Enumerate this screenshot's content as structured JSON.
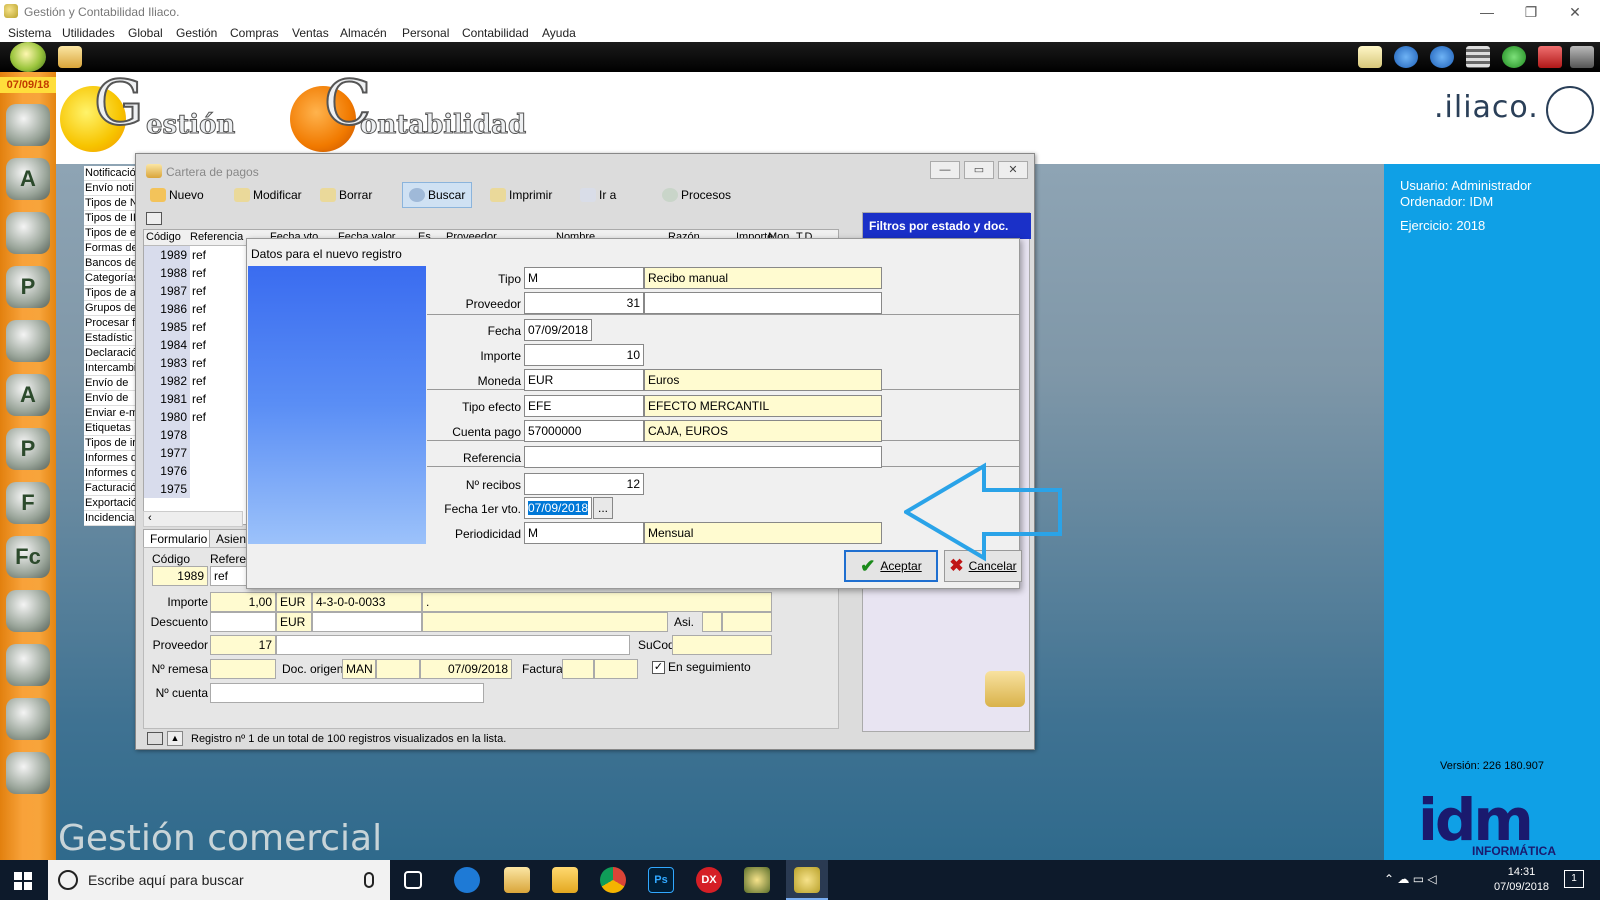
{
  "window": {
    "title": "Gestión y Contabilidad Iliaco.",
    "controls": [
      "—",
      "❐",
      "✕"
    ]
  },
  "menu": [
    "Sistema",
    "Utilidades",
    "Global",
    "Gestión",
    "Compras",
    "Ventas",
    "Almacén",
    "Personal",
    "Contabilidad",
    "Ayuda"
  ],
  "sidebar": {
    "date": "07/09/18"
  },
  "logos": {
    "gestion_letter": "G",
    "gestion_rest": "estión",
    "contab_letter": "C",
    "contab_rest": "ontabilidad",
    "brand": ".iliaco.",
    "footer": "Gestión comercial"
  },
  "user_panel": {
    "usuario": "Usuario: Administrador",
    "ordenador": "Ordenador: IDM",
    "ejercicio": "Ejercicio: 2018",
    "version": "Versión: 226 180.907",
    "idm": "idm",
    "idm_sub": "INFORMÁTICA"
  },
  "bg_list": [
    "Notificació",
    "Envío noti",
    "Tipos de N",
    "Tipos de II",
    "Tipos de e",
    "Formas de",
    "Bancos de",
    "Categorías",
    "Tipos de a",
    "Grupos de",
    "Procesar f",
    "Estadístic",
    "Declaració",
    "Intercambi",
    "Envío de",
    "Envío de",
    "Enviar e-m",
    "Etiquetas",
    "Tipos de ir",
    "Informes d",
    "Informes d",
    "Facturació",
    "Exportació",
    "Incidencia"
  ],
  "cartera": {
    "title": "Cartera de pagos",
    "toolbar": [
      "Nuevo",
      "Modificar",
      "Borrar",
      "Buscar",
      "Imprimir",
      "Ir a",
      "Procesos"
    ],
    "columns": [
      "Código",
      "Referencia",
      "Fecha vto.",
      "Fecha valor",
      "Es",
      "Proveedor",
      "Nombre",
      "Razón",
      "Importe",
      "Mon.",
      "T.D."
    ],
    "rows": [
      {
        "codigo": "1989",
        "ref": "ref"
      },
      {
        "codigo": "1988",
        "ref": "ref"
      },
      {
        "codigo": "1987",
        "ref": "ref"
      },
      {
        "codigo": "1986",
        "ref": "ref"
      },
      {
        "codigo": "1985",
        "ref": "ref"
      },
      {
        "codigo": "1984",
        "ref": "ref"
      },
      {
        "codigo": "1983",
        "ref": "ref"
      },
      {
        "codigo": "1982",
        "ref": "ref"
      },
      {
        "codigo": "1981",
        "ref": "ref"
      },
      {
        "codigo": "1980",
        "ref": "ref"
      },
      {
        "codigo": "1978",
        "ref": ""
      },
      {
        "codigo": "1977",
        "ref": ""
      },
      {
        "codigo": "1976",
        "ref": ""
      },
      {
        "codigo": "1975",
        "ref": ""
      }
    ],
    "tabs": [
      "Formulario",
      "Asiento"
    ],
    "filters_title": "Filtros por estado y doc.",
    "form": {
      "codigo_label": "Código",
      "codigo": "1989",
      "referencia_label": "Referencia",
      "referencia": "ref",
      "importe_label": "Importe",
      "importe": "1,00",
      "importe_mon": "EUR",
      "cuenta": "4-3-0-0-0033",
      "cuenta_nombre": ".",
      "descuento_label": "Descuento",
      "descuento_mon": "EUR",
      "asi_label": "Asi.",
      "proveedor_label": "Proveedor",
      "proveedor": "17",
      "sucod_label": "SuCod",
      "remesa_label": "Nº remesa",
      "doc_origen_label": "Doc. origen",
      "doc_origen": "MAN",
      "doc_fecha": "07/09/2018",
      "factura_label": "Factura",
      "seguimiento_label": "En seguimiento",
      "cuenta_label": "Nº cuenta"
    },
    "status": "Registro nº 1 de un total de 100 registros visualizados en la lista."
  },
  "dialog": {
    "title": "Datos para el nuevo registro",
    "fields": {
      "tipo_label": "Tipo",
      "tipo": "M",
      "tipo_desc": "Recibo manual",
      "proveedor_label": "Proveedor",
      "proveedor": "31",
      "fecha_label": "Fecha",
      "fecha": "07/09/2018",
      "importe_label": "Importe",
      "importe": "10",
      "moneda_label": "Moneda",
      "moneda": "EUR",
      "moneda_desc": "Euros",
      "tipo_efecto_label": "Tipo efecto",
      "tipo_efecto": "EFE",
      "tipo_efecto_desc": "EFECTO MERCANTIL",
      "cuenta_pago_label": "Cuenta pago",
      "cuenta_pago": "57000000",
      "cuenta_pago_desc": "CAJA, EUROS",
      "referencia_label": "Referencia",
      "recibos_label": "Nº recibos",
      "recibos": "12",
      "fecha_vto_label": "Fecha 1er vto.",
      "fecha_vto": "07/09/2018",
      "picker": "...",
      "periodicidad_label": "Periodicidad",
      "periodicidad": "M",
      "periodicidad_desc": "Mensual"
    },
    "aceptar": "Aceptar",
    "cancelar": "Cancelar"
  },
  "taskbar": {
    "search_placeholder": "Escribe aquí para buscar",
    "time": "14:31",
    "date": "07/09/2018",
    "notif_count": "1"
  }
}
